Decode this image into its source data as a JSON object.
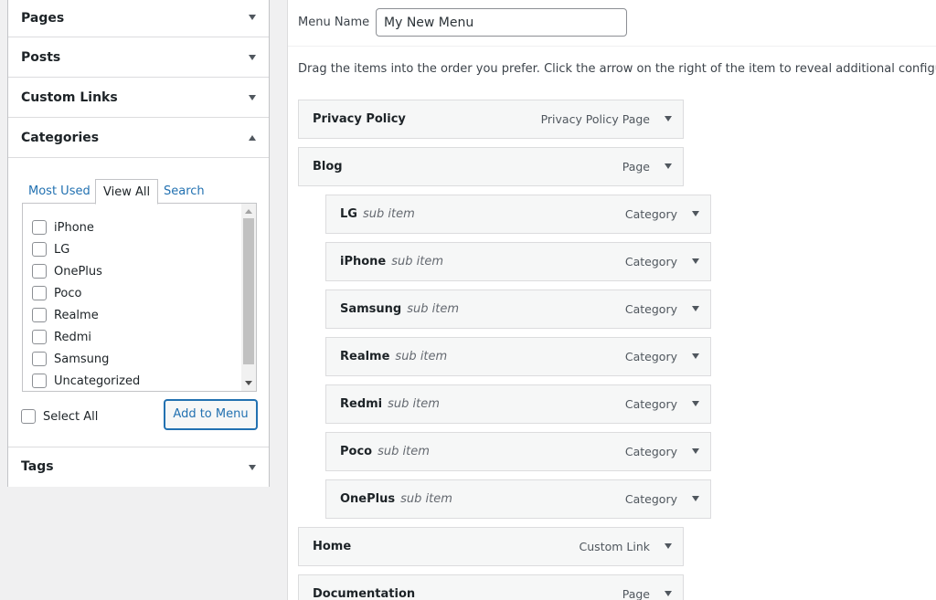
{
  "left": {
    "sections": {
      "pages": "Pages",
      "posts": "Posts",
      "custom_links": "Custom Links",
      "categories": "Categories",
      "tags": "Tags"
    },
    "tabs": {
      "most_used": "Most Used",
      "view_all": "View All",
      "search": "Search"
    },
    "categories": [
      "iPhone",
      "LG",
      "OnePlus",
      "Poco",
      "Realme",
      "Redmi",
      "Samsung",
      "Uncategorized"
    ],
    "select_all": "Select All",
    "add_button": "Add to Menu"
  },
  "right": {
    "menu_name_label": "Menu Name",
    "menu_name_value": "My New Menu",
    "drag_hint": "Drag the items into the order you prefer. Click the arrow on the right of the item to reveal additional configuration optio",
    "sub_item_label": "sub item",
    "items": [
      {
        "title": "Privacy Policy",
        "type": "Privacy Policy Page",
        "level": 0
      },
      {
        "title": "Blog",
        "type": "Page",
        "level": 0
      },
      {
        "title": "LG",
        "type": "Category",
        "level": 1
      },
      {
        "title": "iPhone",
        "type": "Category",
        "level": 1
      },
      {
        "title": "Samsung",
        "type": "Category",
        "level": 1
      },
      {
        "title": "Realme",
        "type": "Category",
        "level": 1
      },
      {
        "title": "Redmi",
        "type": "Category",
        "level": 1
      },
      {
        "title": "Poco",
        "type": "Category",
        "level": 1
      },
      {
        "title": "OnePlus",
        "type": "Category",
        "level": 1
      },
      {
        "title": "Home",
        "type": "Custom Link",
        "level": 0
      },
      {
        "title": "Documentation",
        "type": "Page",
        "level": 0
      }
    ]
  }
}
